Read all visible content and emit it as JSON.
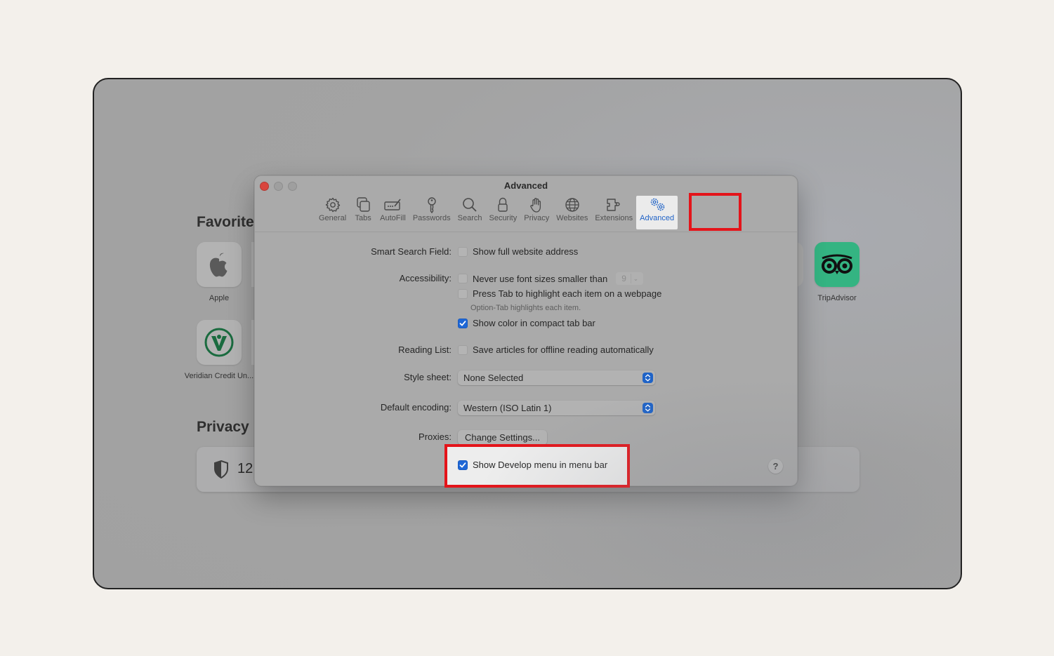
{
  "background": {
    "favorites_title": "Favorites",
    "privacy_title": "Privacy",
    "privacy_count": "12",
    "favorites": [
      {
        "label": "Apple",
        "icon": "apple-logo-icon"
      },
      {
        "label": "Veridian Credit Un...",
        "icon": "veridian-logo-icon"
      },
      {
        "label": "TripAdvisor",
        "icon": "tripadvisor-owl-icon"
      }
    ]
  },
  "dialog": {
    "title": "Advanced",
    "window_controls": [
      "close",
      "minimize",
      "zoom"
    ],
    "toolbar": [
      {
        "label": "General",
        "icon": "gear-icon"
      },
      {
        "label": "Tabs",
        "icon": "tabs-icon"
      },
      {
        "label": "AutoFill",
        "icon": "autofill-icon"
      },
      {
        "label": "Passwords",
        "icon": "key-icon"
      },
      {
        "label": "Search",
        "icon": "magnifier-icon"
      },
      {
        "label": "Security",
        "icon": "lock-icon"
      },
      {
        "label": "Privacy",
        "icon": "hand-icon"
      },
      {
        "label": "Websites",
        "icon": "globe-icon"
      },
      {
        "label": "Extensions",
        "icon": "puzzle-icon"
      },
      {
        "label": "Advanced",
        "icon": "gears-icon",
        "active": true
      }
    ],
    "settings": {
      "smart_search": {
        "label": "Smart Search Field:",
        "option": "Show full website address",
        "checked": false
      },
      "accessibility": {
        "label": "Accessibility:",
        "min_font": {
          "option": "Never use font sizes smaller than",
          "checked": false,
          "value": "9"
        },
        "press_tab": {
          "option": "Press Tab to highlight each item on a webpage",
          "checked": false,
          "hint": "Option-Tab highlights each item."
        },
        "show_color": {
          "option": "Show color in compact tab bar",
          "checked": true
        }
      },
      "reading_list": {
        "label": "Reading List:",
        "option": "Save articles for offline reading automatically",
        "checked": false
      },
      "style_sheet": {
        "label": "Style sheet:",
        "value": "None Selected"
      },
      "default_encoding": {
        "label": "Default encoding:",
        "value": "Western (ISO Latin 1)"
      },
      "proxies": {
        "label": "Proxies:",
        "button": "Change Settings..."
      },
      "develop_menu": {
        "option": "Show Develop menu in menu bar",
        "checked": true
      }
    },
    "help_label": "?"
  },
  "colors": {
    "accent": "#1f63c7",
    "highlight": "#e4141a",
    "tripadvisor": "#34c08a",
    "veridian": "#1a6b3f"
  }
}
